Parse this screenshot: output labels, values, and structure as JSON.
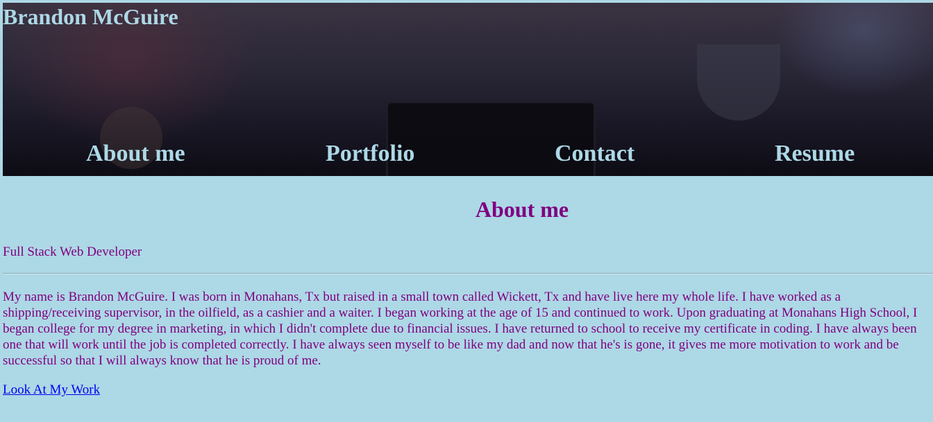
{
  "header": {
    "site_title": "Brandon McGuire"
  },
  "nav": {
    "items": [
      {
        "label": "About me"
      },
      {
        "label": "Portfolio"
      },
      {
        "label": "Contact"
      },
      {
        "label": "Resume"
      }
    ]
  },
  "about": {
    "heading": "About me",
    "subtitle": "Full Stack Web Developer",
    "bio": "My name is Brandon McGuire. I was born in Monahans, Tx but raised in a small town called Wickett, Tx and have live here my whole life. I have worked as a shipping/receiving supervisor, in the oilfield, as a cashier and a waiter. I began working at the age of 15 and continued to work. Upon graduating at Monahans High School, I began college for my degree in marketing, in which I didn't complete due to financial issues. I have returned to school to receive my certificate in coding. I have always been one that will work until the job is completed correctly. I have always seen myself to be like my dad and now that he's is gone, it gives me more motivation to work and be successful so that I will always know that he is proud of me.",
    "link_label": "Look At My Work"
  },
  "colors": {
    "page_background": "#add8e6",
    "header_text": "#add8e6",
    "body_text": "#800080",
    "link": "#0000ee"
  }
}
